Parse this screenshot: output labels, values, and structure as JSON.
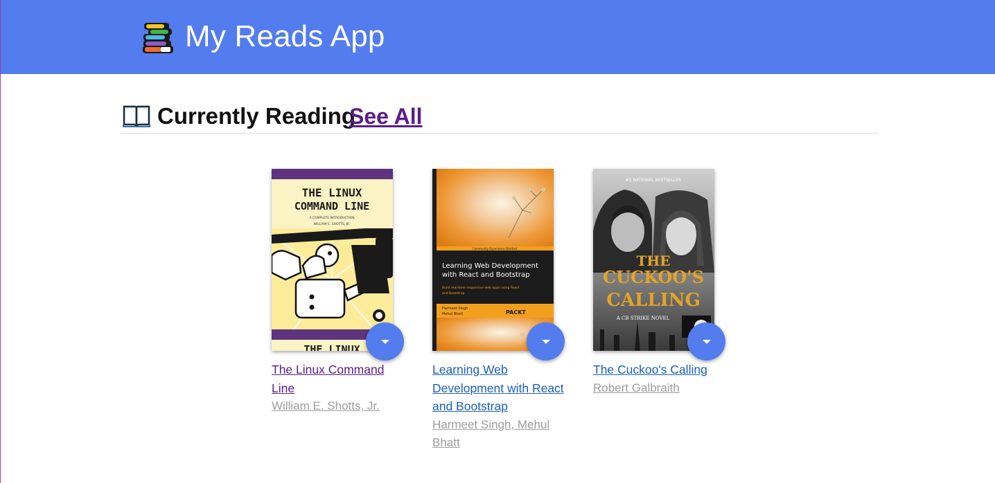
{
  "header": {
    "title": "My Reads App",
    "logo_icon": "books-stack-icon"
  },
  "shelf": {
    "icon": "open-book-icon",
    "title": "Currently Reading",
    "see_all_label": "See All"
  },
  "books": [
    {
      "title": "The Linux Command Line",
      "authors": "William E. Shotts, Jr.",
      "cover_text": {
        "line1": "THE LINUX",
        "line2": "COMMAND LINE",
        "line3": "A COMPLETE INTRODUCTION",
        "line4": "WILLIAM E. SHOTTS, JR.",
        "bottom": "THE LINUX"
      },
      "menu_icon": "caret-down-icon"
    },
    {
      "title": "Learning Web Development with React and Bootstrap",
      "authors": "Harmeet Singh, Mehul Bhatt",
      "cover_text": {
        "series": "Community Experience Distilled",
        "line1": "Learning Web Development",
        "line2": "with React and Bootstrap",
        "sub1": "Build real-time responsive web apps using React",
        "sub2": "and Bootstrap",
        "author1": "Harmeet Singh",
        "author2": "Mehul Bhatt",
        "publisher": "PACKT"
      },
      "menu_icon": "caret-down-icon"
    },
    {
      "title": "The Cuckoo's Calling",
      "authors": "Robert Galbraith",
      "cover_text": {
        "top": "#1 NATIONAL BESTSELLER",
        "line1": "THE",
        "line2": "CUCKOO'S",
        "line3": "CALLING",
        "sub": "A CB STRIKE NOVEL"
      },
      "menu_icon": "caret-down-icon"
    }
  ],
  "colors": {
    "header_bg": "#537cee",
    "visited_link": "#5b1c8c",
    "link": "#1a5fc2",
    "author": "#9c9c9c"
  }
}
